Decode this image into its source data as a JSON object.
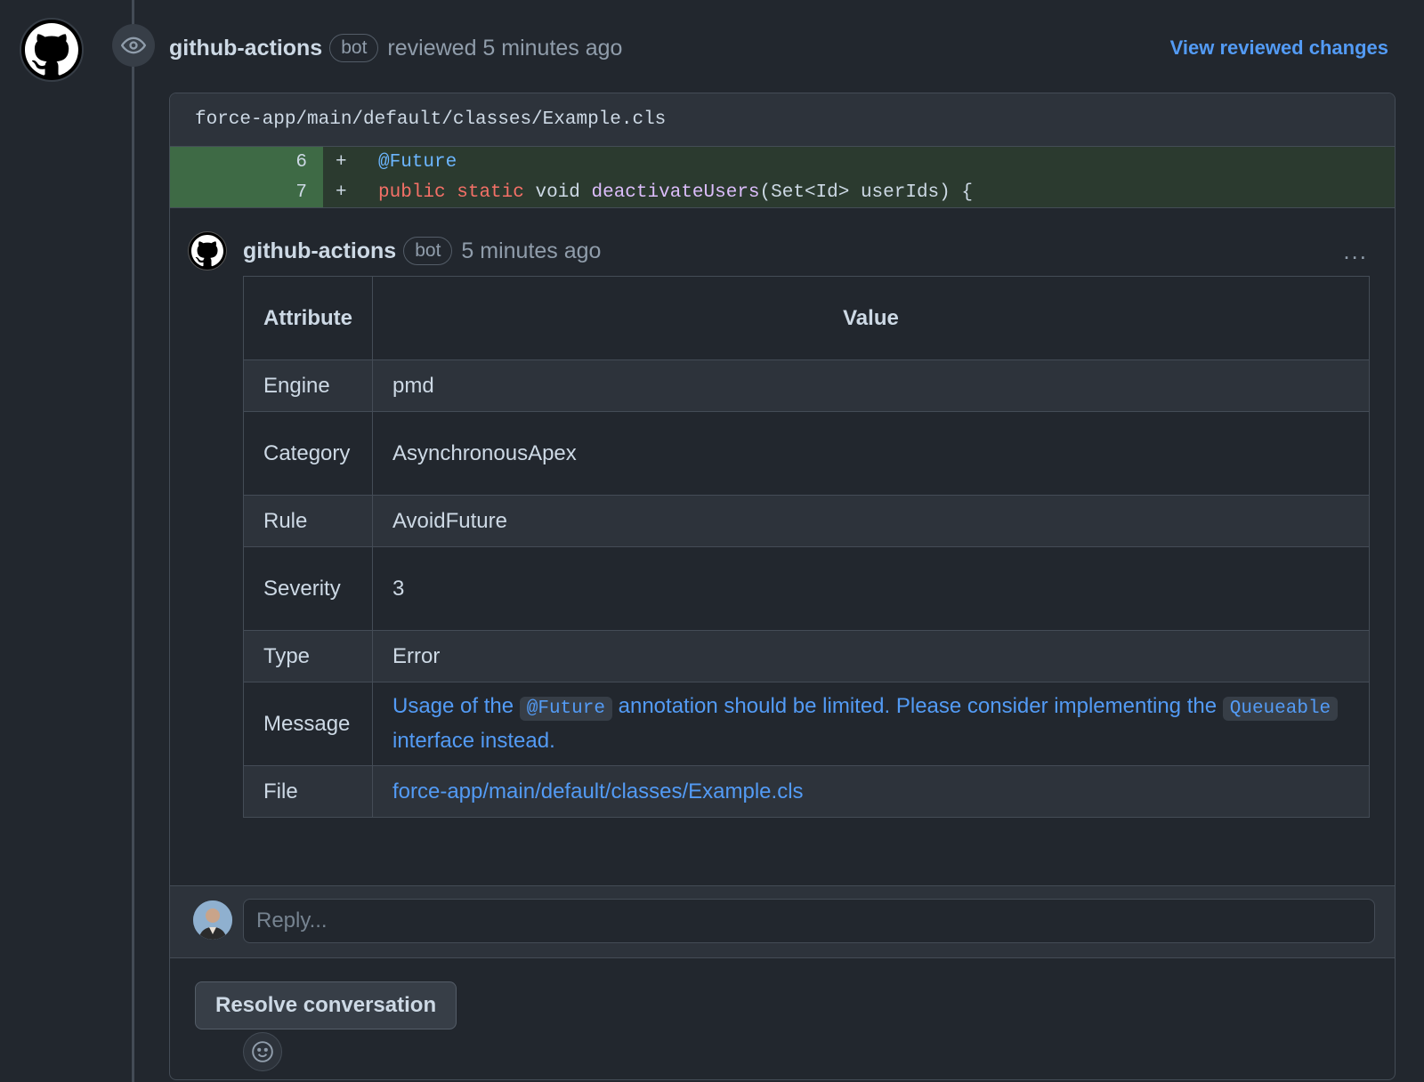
{
  "review": {
    "author": "github-actions",
    "bot_label": "bot",
    "action_text": "reviewed 5 minutes ago",
    "view_changes_label": "View reviewed changes"
  },
  "file": {
    "path": "force-app/main/default/classes/Example.cls"
  },
  "diff": {
    "lines": [
      {
        "number": "6",
        "sign": "+",
        "annotation": "@Future"
      },
      {
        "number": "7",
        "sign": "+",
        "kw1": "public",
        "kw2": "static",
        "type": "void",
        "method": "deactivateUsers",
        "rest": "(Set<Id> userIds) {"
      }
    ]
  },
  "comment": {
    "author": "github-actions",
    "bot_label": "bot",
    "time": "5 minutes ago",
    "more_label": "...",
    "table": {
      "headers": [
        "Attribute",
        "Value"
      ],
      "rows": [
        {
          "attr": "Engine",
          "value": "pmd"
        },
        {
          "attr": "Category",
          "value": "AsynchronousApex"
        },
        {
          "attr": "Rule",
          "value": "AvoidFuture"
        },
        {
          "attr": "Severity",
          "value": "3"
        },
        {
          "attr": "Type",
          "value": "Error"
        },
        {
          "attr": "Message",
          "message_part1": "Usage of the",
          "message_code1": "@Future",
          "message_part2": "annotation should be limited. Please consider implementing the",
          "message_code2": "Queueable",
          "message_part3": "interface instead."
        },
        {
          "attr": "File",
          "value": "force-app/main/default/classes/Example.cls"
        }
      ]
    }
  },
  "reply": {
    "placeholder": "Reply..."
  },
  "resolve_label": "Resolve conversation",
  "colors": {
    "background": "#22272e",
    "link": "#539bf5",
    "diff_added": "#3e6a45"
  },
  "icons": [
    "github-logo-icon",
    "eye-icon",
    "kebab-icon",
    "smiley-icon"
  ]
}
